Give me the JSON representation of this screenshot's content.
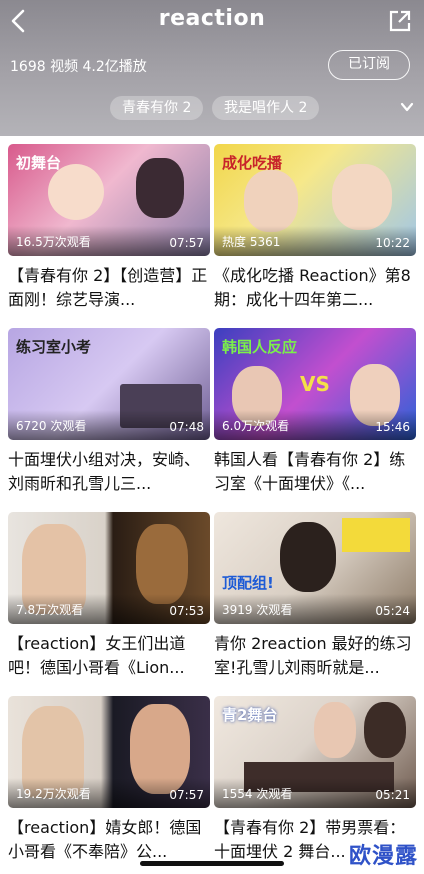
{
  "header": {
    "title": "reaction",
    "stats": "1698 视频 4.2亿播放",
    "subscribe_label": "已订阅",
    "chips": [
      "青春有你 2",
      "我是唱作人 2"
    ]
  },
  "icons": {
    "back": "back-chevron-icon",
    "share": "share-icon",
    "expand": "chevron-down-icon"
  },
  "videos": [
    {
      "views": "16.5万次观看",
      "duration": "07:57",
      "title": "【青春有你 2】【创造营】正面刚！综艺导演...",
      "thumb_caption": "初舞台"
    },
    {
      "views": "热度 5361",
      "duration": "10:22",
      "title": "《成化吃播 Reaction》第8期：成化十四年第二...",
      "thumb_caption": "成化吃播"
    },
    {
      "views": "6720 次观看",
      "duration": "07:48",
      "title": "十面埋伏小组对决，安崎、刘雨昕和孔雪儿三...",
      "thumb_caption": "练习室小考"
    },
    {
      "views": "6.0万次观看",
      "duration": "15:46",
      "title": "韩国人看【青春有你 2】练习室《十面埋伏》《...",
      "thumb_caption": "韩国人反应"
    },
    {
      "views": "7.8万次观看",
      "duration": "07:53",
      "title": "【reaction】女王们出道吧！德国小哥看《Lion...",
      "thumb_caption": ""
    },
    {
      "views": "3919 次观看",
      "duration": "05:24",
      "title": "青你 2reaction 最好的练习室!孔雪儿刘雨昕就是...",
      "thumb_caption": "顶配组!"
    },
    {
      "views": "19.2万次观看",
      "duration": "07:57",
      "title": "【reaction】婧女郎！德国小哥看《不奉陪》公...",
      "thumb_caption": ""
    },
    {
      "views": "1554 次观看",
      "duration": "05:21",
      "title": "【青春有你 2】带男票看：十面埋伏 2 舞台...",
      "thumb_caption": "青2舞台"
    }
  ],
  "watermark": "欧漫露",
  "colors": {
    "header_top": "#8b8990",
    "header_bottom": "#b4b3b8",
    "watermark": "#2f52c8"
  }
}
